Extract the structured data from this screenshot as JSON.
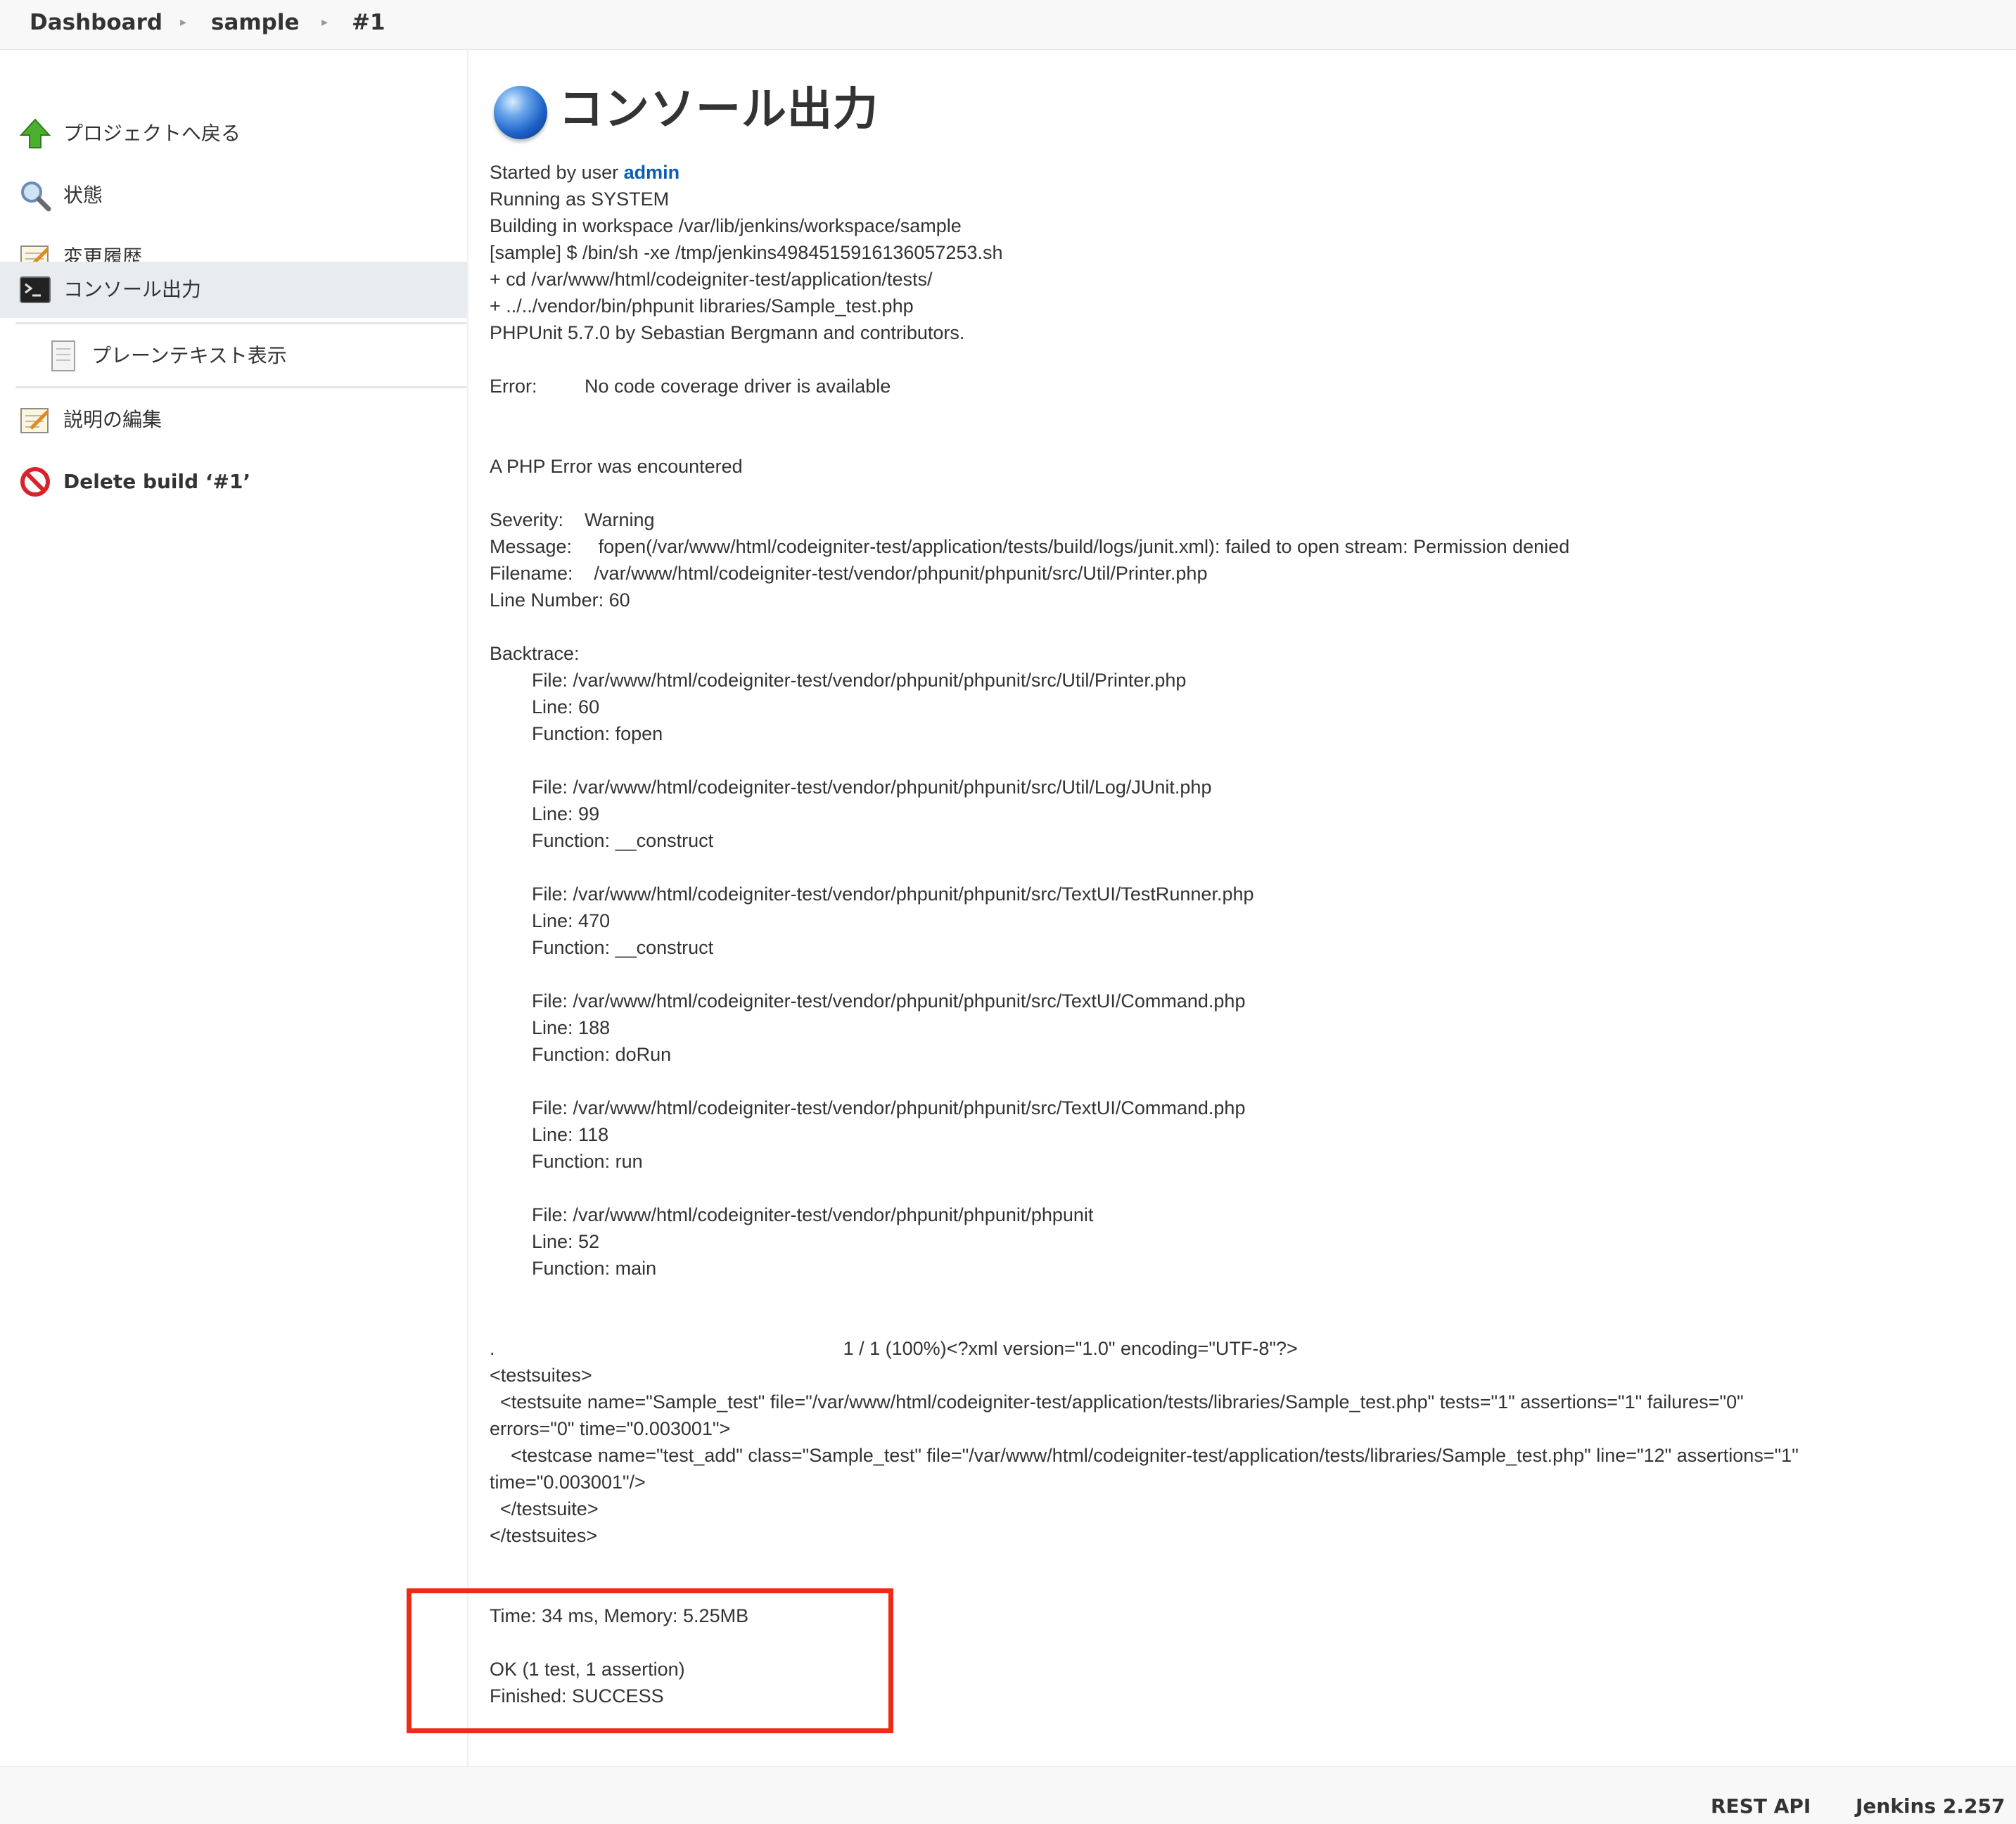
{
  "breadcrumb": {
    "items": [
      "Dashboard",
      "sample",
      "#1"
    ]
  },
  "sidebar": {
    "items": [
      {
        "label": "プロジェクトへ戻る",
        "icon": "up-arrow-icon"
      },
      {
        "label": "状態",
        "icon": "search-icon"
      },
      {
        "label": "変更履歴",
        "icon": "notepad-icon"
      },
      {
        "label": "コンソール出力",
        "icon": "terminal-icon"
      },
      {
        "label": "プレーンテキスト表示",
        "icon": "document-icon"
      },
      {
        "label": "説明の編集",
        "icon": "notepad-icon"
      },
      {
        "label": "Delete build ‘#1’",
        "icon": "no-entry-icon"
      }
    ],
    "active_index": 3
  },
  "main": {
    "title": "コンソール出力",
    "title_icon": "blue-ball-icon",
    "console": {
      "started_prefix": "Started by user ",
      "started_user": "admin",
      "lines": [
        "Running as SYSTEM",
        "Building in workspace /var/lib/jenkins/workspace/sample",
        "[sample] $ /bin/sh -xe /tmp/jenkins4984515916136057253.sh",
        "+ cd /var/www/html/codeigniter-test/application/tests/",
        "+ ../../vendor/bin/phpunit libraries/Sample_test.php",
        "PHPUnit 5.7.0 by Sebastian Bergmann and contributors.",
        "",
        "Error:         No code coverage driver is available",
        "",
        "",
        "A PHP Error was encountered",
        "",
        "Severity:    Warning",
        "Message:     fopen(/var/www/html/codeigniter-test/application/tests/build/logs/junit.xml): failed to open stream: Permission denied",
        "Filename:    /var/www/html/codeigniter-test/vendor/phpunit/phpunit/src/Util/Printer.php",
        "Line Number: 60",
        "",
        "Backtrace:",
        "        File: /var/www/html/codeigniter-test/vendor/phpunit/phpunit/src/Util/Printer.php",
        "        Line: 60",
        "        Function: fopen",
        "",
        "        File: /var/www/html/codeigniter-test/vendor/phpunit/phpunit/src/Util/Log/JUnit.php",
        "        Line: 99",
        "        Function: __construct",
        "",
        "        File: /var/www/html/codeigniter-test/vendor/phpunit/phpunit/src/TextUI/TestRunner.php",
        "        Line: 470",
        "        Function: __construct",
        "",
        "        File: /var/www/html/codeigniter-test/vendor/phpunit/phpunit/src/TextUI/Command.php",
        "        Line: 188",
        "        Function: doRun",
        "",
        "        File: /var/www/html/codeigniter-test/vendor/phpunit/phpunit/src/TextUI/Command.php",
        "        Line: 118",
        "        Function: run",
        "",
        "        File: /var/www/html/codeigniter-test/vendor/phpunit/phpunit/phpunit",
        "        Line: 52",
        "        Function: main",
        "",
        "",
        ".                                                                  1 / 1 (100%)<?xml version=\"1.0\" encoding=\"UTF-8\"?>",
        "<testsuites>",
        "  <testsuite name=\"Sample_test\" file=\"/var/www/html/codeigniter-test/application/tests/libraries/Sample_test.php\" tests=\"1\" assertions=\"1\" failures=\"0\"",
        "errors=\"0\" time=\"0.003001\">",
        "    <testcase name=\"test_add\" class=\"Sample_test\" file=\"/var/www/html/codeigniter-test/application/tests/libraries/Sample_test.php\" line=\"12\" assertions=\"1\"",
        "time=\"0.003001\"/>",
        "  </testsuite>",
        "</testsuites>",
        "",
        "",
        "Time: 34 ms, Memory: 5.25MB",
        "",
        "OK (1 test, 1 assertion)",
        "Finished: SUCCESS"
      ]
    },
    "highlight_color": "#ee2b15"
  },
  "footer": {
    "rest_api": "REST API",
    "version": "Jenkins 2.257"
  }
}
